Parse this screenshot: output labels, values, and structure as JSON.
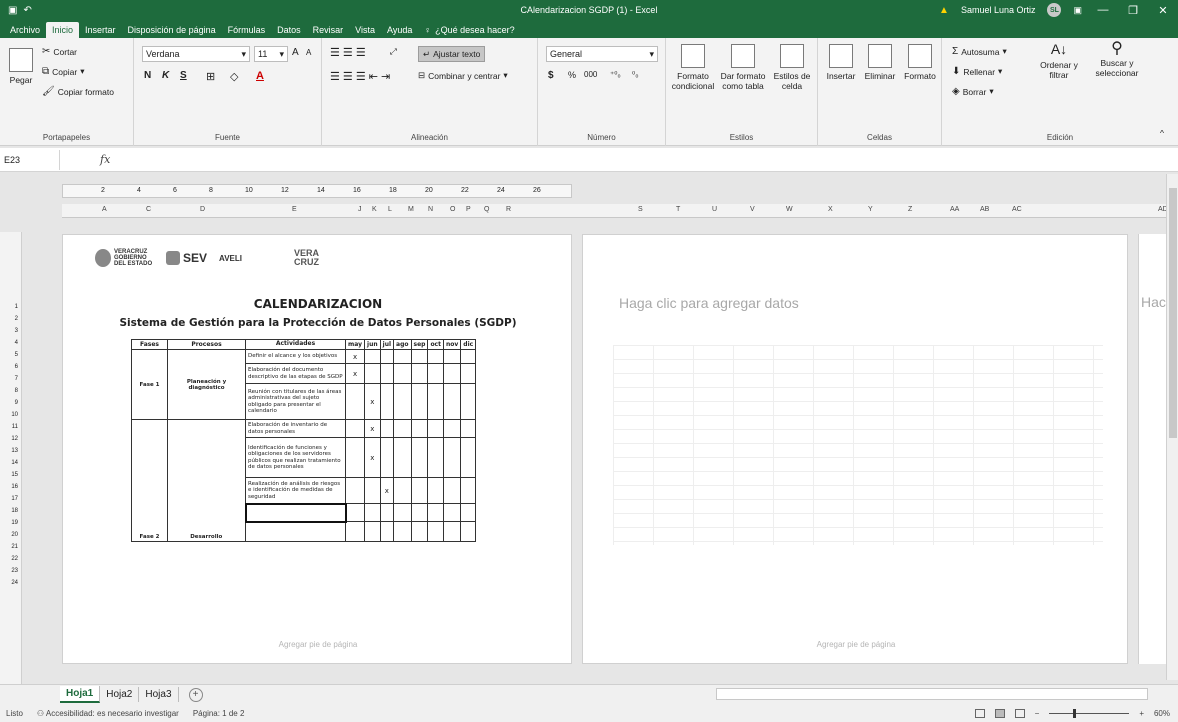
{
  "window": {
    "title": "CAlendarizacion SGDP (1) - Excel",
    "user_name": "Samuel Luna Ortiz",
    "user_initials": "SL",
    "qat_undo": "↶",
    "minimize": "—",
    "restore": "❐",
    "close": "✕"
  },
  "tabs": [
    "Archivo",
    "Inicio",
    "Insertar",
    "Disposición de página",
    "Fórmulas",
    "Datos",
    "Revisar",
    "Vista",
    "Ayuda"
  ],
  "tell_me": "¿Qué desea hacer?",
  "ribbon": {
    "clipboard": {
      "paste": "Pegar",
      "cut": "Cortar",
      "copy": "Copiar",
      "format_painter": "Copiar formato",
      "label": "Portapapeles"
    },
    "font": {
      "name": "Verdana",
      "size": "11",
      "bold": "N",
      "italic": "K",
      "underline": "S",
      "label": "Fuente"
    },
    "alignment": {
      "wrap": "Ajustar texto",
      "merge": "Combinar y centrar",
      "label": "Alineación"
    },
    "number": {
      "format": "General",
      "currency": "$",
      "percent": "%",
      "thousands": "000",
      "label": "Número"
    },
    "styles": {
      "conditional": "Formato condicional",
      "as_table": "Dar formato como tabla",
      "cell_styles": "Estilos de celda",
      "label": "Estilos"
    },
    "cells": {
      "insert": "Insertar",
      "delete": "Eliminar",
      "format": "Formato",
      "label": "Celdas"
    },
    "editing": {
      "autosum": "Autosuma",
      "fill": "Rellenar",
      "clear": "Borrar",
      "sort": "Ordenar y filtrar",
      "find": "Buscar y seleccionar",
      "label": "Edición"
    }
  },
  "formula_bar": {
    "name_box": "E23",
    "fx": "fx",
    "value": ""
  },
  "ruler": [
    "2",
    "4",
    "6",
    "8",
    "10",
    "12",
    "14",
    "16",
    "18",
    "20",
    "22",
    "24",
    "26"
  ],
  "columns": [
    "A",
    "C",
    "D",
    "E",
    "J",
    "K",
    "L",
    "M",
    "N",
    "O",
    "P",
    "Q",
    "R",
    "S",
    "T",
    "U",
    "V",
    "W",
    "X",
    "Y",
    "Z",
    "AA",
    "AB",
    "AC",
    "AD"
  ],
  "rows": [
    "1",
    "2",
    "3",
    "4",
    "5",
    "6",
    "7",
    "8",
    "9",
    "10",
    "11",
    "12",
    "13",
    "14",
    "15",
    "16",
    "17",
    "18",
    "19",
    "20",
    "21",
    "22",
    "23",
    "24"
  ],
  "page1": {
    "logos": {
      "veracruz": "VERACRUZ GOBIERNO DEL ESTADO",
      "sev": "SEV",
      "aveli": "AVELI",
      "vera": "VERA CRUZ"
    },
    "title": "CALENDARIZACION",
    "subtitle": "Sistema de Gestión para la Protección de Datos Personales (SGDP)",
    "table": {
      "headers": [
        "Fases",
        "Procesos",
        "Actividades",
        "may",
        "jun",
        "jul",
        "ago",
        "sep",
        "oct",
        "nov",
        "dic"
      ],
      "rows": [
        {
          "fase": "Fase 1",
          "proceso": "Planeación y diagnóstico",
          "actividad": "Definir el alcance y los objetivos",
          "mark": 0
        },
        {
          "fase": "",
          "proceso": "",
          "actividad": "Elaboración del documento descriptivo de las etapas de SGDP",
          "mark": 0
        },
        {
          "fase": "",
          "proceso": "",
          "actividad": "Reunión con titulares de las áreas administrativas del sujeto obligado para presentar el calendario",
          "mark": 1
        },
        {
          "fase": "Fase 2",
          "proceso": "Desarrollo",
          "actividad": "Elaboración de inventario de datos personales",
          "mark": 1
        },
        {
          "fase": "",
          "proceso": "",
          "actividad": "Identificación de funciones y obligaciones de los servidores públicos que realizan tratamiento de datos personales",
          "mark": 1
        },
        {
          "fase": "",
          "proceso": "",
          "actividad": "Realización de análisis de riesgos e identificación de medidas de seguridad",
          "mark": 2
        },
        {
          "fase": "",
          "proceso": "",
          "actividad": "",
          "mark": -1
        },
        {
          "fase": "",
          "proceso": "",
          "actividad": "",
          "mark": -1
        }
      ],
      "mark_symbol": "x"
    },
    "footer": "Agregar pie de página"
  },
  "page2": {
    "placeholder": "Haga clic para agregar datos",
    "footer": "Agregar pie de página"
  },
  "page3": {
    "placeholder": "Hac"
  },
  "sheets": [
    "Hoja1",
    "Hoja2",
    "Hoja3"
  ],
  "add_sheet": "+",
  "status": {
    "ready": "Listo",
    "accessibility": "Accesibilidad: es necesario investigar",
    "page": "Página: 1 de 2",
    "zoom": "60%",
    "zoom_minus": "−",
    "zoom_plus": "+"
  }
}
